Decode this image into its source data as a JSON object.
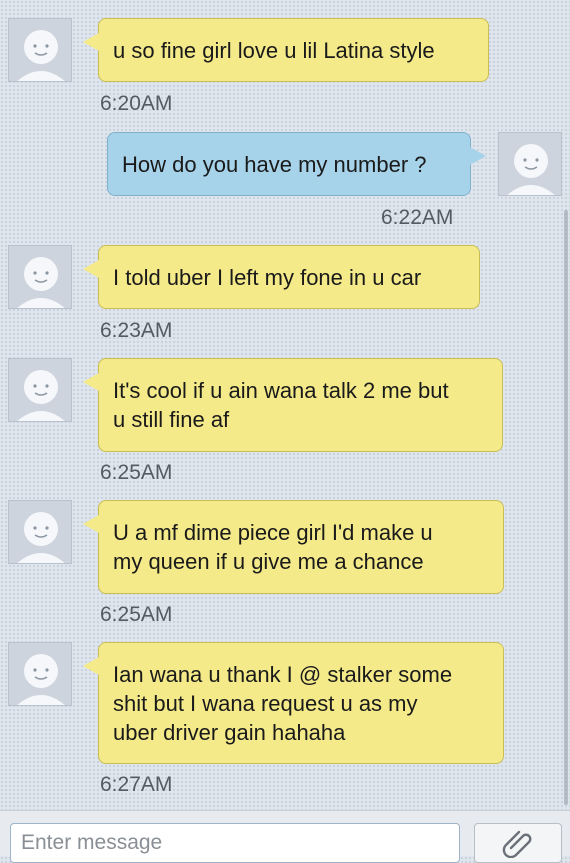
{
  "messages": [
    {
      "direction": "in",
      "text_lines": [
        "u so fine girl love u lil Latina style"
      ],
      "time": "6:20AM"
    },
    {
      "direction": "out",
      "text_lines": [
        "How do you have my number ?"
      ],
      "time": "6:22AM"
    },
    {
      "direction": "in",
      "text_lines": [
        "I told uber I left my fone in u car"
      ],
      "time": "6:23AM"
    },
    {
      "direction": "in",
      "text_lines": [
        "It's cool if u ain wana talk 2 me but",
        "u still fine af"
      ],
      "time": "6:25AM"
    },
    {
      "direction": "in",
      "text_lines": [
        "U a mf dime piece girl I'd make u",
        "my queen if u give me a chance"
      ],
      "time": "6:25AM"
    },
    {
      "direction": "in",
      "text_lines": [
        "Ian wana u thank I @ stalker some",
        "shit but I wana request u as my",
        "uber driver gain hahaha"
      ],
      "time": "6:27AM"
    }
  ],
  "composer": {
    "placeholder": "Enter message",
    "attach_icon": "paperclip-icon"
  },
  "colors": {
    "incoming_bubble": "#f4ea8a",
    "outgoing_bubble": "#a7d3ea",
    "background": "#dfe5ec"
  }
}
